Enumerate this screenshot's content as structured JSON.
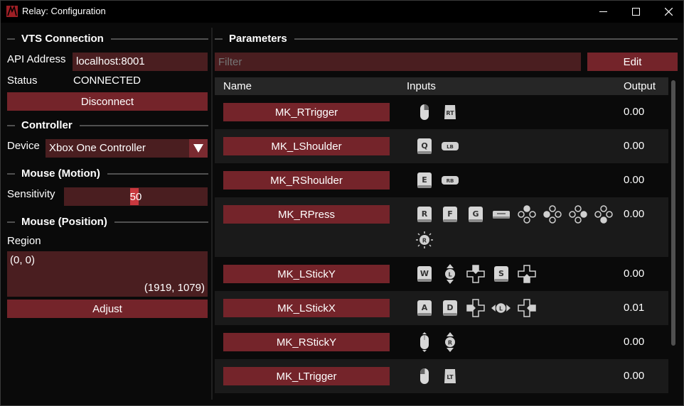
{
  "window": {
    "title": "Relay: Configuration",
    "controls": [
      "minimize-icon",
      "maximize-icon",
      "close-icon"
    ]
  },
  "colors": {
    "accent": "#74242a",
    "field": "#4a1e20",
    "slider_grab": "#c8383e",
    "background": "#0a0a0a"
  },
  "vts": {
    "heading": "VTS Connection",
    "api_label": "API Address",
    "api_value": "localhost:8001",
    "status_label": "Status",
    "status_value": "CONNECTED",
    "disconnect_label": "Disconnect"
  },
  "controller": {
    "heading": "Controller",
    "device_label": "Device",
    "device_value": "Xbox One Controller"
  },
  "mouse_motion": {
    "heading": "Mouse (Motion)",
    "sensitivity_label": "Sensitivity",
    "sensitivity_value": "50"
  },
  "mouse_position": {
    "heading": "Mouse (Position)",
    "region_label": "Region",
    "region_top_left": "(0, 0)",
    "region_bottom_right": "(1919, 1079)",
    "adjust_label": "Adjust"
  },
  "parameters": {
    "heading": "Parameters",
    "filter_placeholder": "Filter",
    "edit_label": "Edit",
    "columns": {
      "name": "Name",
      "inputs": "Inputs",
      "output": "Output"
    },
    "rows": [
      {
        "name": "MK_RTrigger",
        "output": "0.00",
        "inputs": [
          "mouse-right-button-icon",
          "rt-button-icon"
        ]
      },
      {
        "name": "MK_LShoulder",
        "output": "0.00",
        "inputs": [
          "q-key-icon",
          "lb-button-icon"
        ]
      },
      {
        "name": "MK_RShoulder",
        "output": "0.00",
        "inputs": [
          "e-key-icon",
          "rb-button-icon"
        ]
      },
      {
        "name": "MK_RPress",
        "output": "0.00",
        "inputs": [
          "r-key-icon",
          "f-key-icon",
          "g-key-icon",
          "space-key-icon",
          "face-button-top-icon",
          "face-button-left-icon",
          "face-button-right-icon",
          "face-button-bottom-icon",
          "right-stick-press-icon"
        ]
      },
      {
        "name": "MK_LStickY",
        "output": "0.00",
        "inputs": [
          "w-key-icon",
          "left-stick-vertical-icon",
          "dpad-up-icon",
          "s-key-icon",
          "dpad-down-icon"
        ]
      },
      {
        "name": "MK_LStickX",
        "output": "0.01",
        "inputs": [
          "a-key-icon",
          "d-key-icon",
          "dpad-left-icon",
          "left-stick-horizontal-icon",
          "dpad-right-icon"
        ]
      },
      {
        "name": "MK_RStickY",
        "output": "0.00",
        "inputs": [
          "mouse-vertical-icon",
          "right-stick-vertical-icon"
        ]
      },
      {
        "name": "MK_LTrigger",
        "output": "0.00",
        "inputs": [
          "mouse-left-button-icon",
          "lt-button-icon"
        ]
      }
    ]
  }
}
